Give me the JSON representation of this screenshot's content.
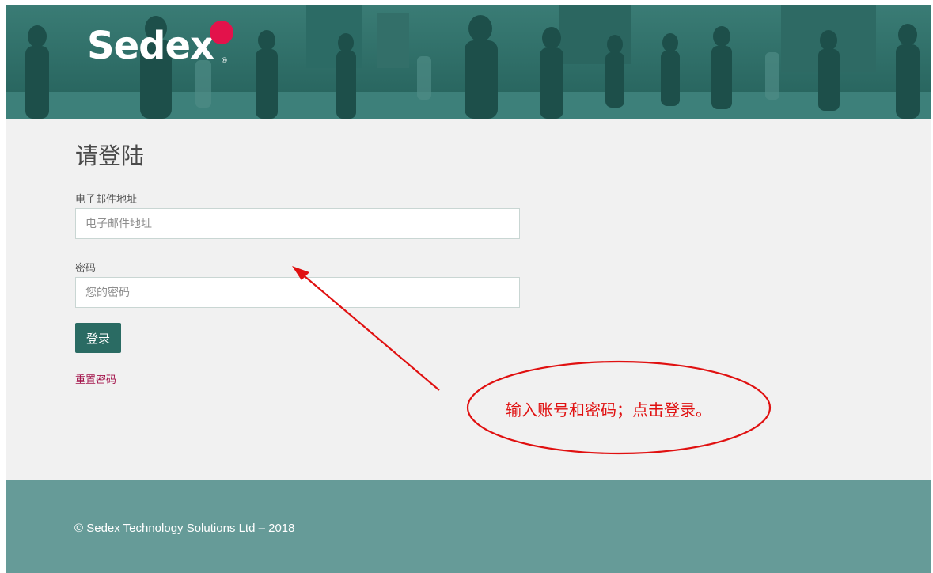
{
  "header": {
    "logo_text": "Sedex",
    "logo_reg": "®",
    "colors": {
      "banner": "#2f6e68",
      "logo_dot": "#e3124b"
    }
  },
  "login": {
    "title": "请登陆",
    "email": {
      "label": "电子邮件地址",
      "placeholder": "电子邮件地址",
      "value": ""
    },
    "password": {
      "label": "密码",
      "placeholder": "您的密码",
      "value": ""
    },
    "submit_label": "登录",
    "reset_link": "重置密码"
  },
  "annotation": {
    "text": "输入账号和密码；点击登录。",
    "color": "#e01010"
  },
  "footer": {
    "copyright": "© Sedex Technology Solutions Ltd – 2018",
    "color": "#669b98"
  },
  "colors": {
    "primary_button": "#2a6b63",
    "link": "#a3134a",
    "page_bg": "#f1f1f1"
  }
}
